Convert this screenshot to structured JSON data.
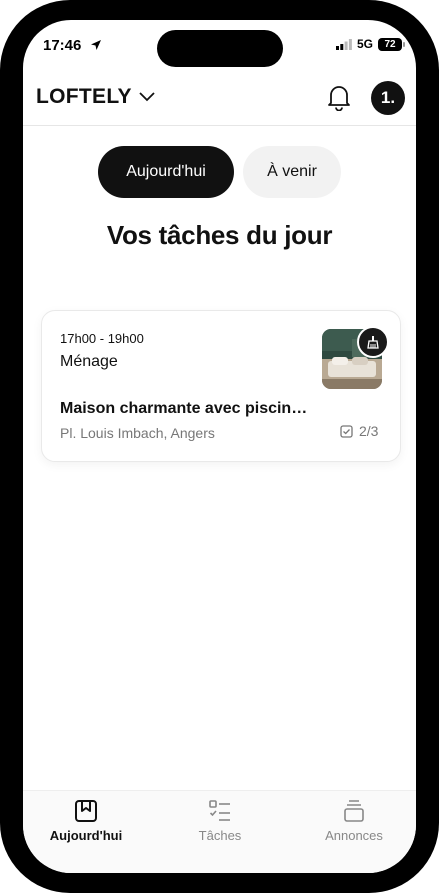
{
  "status_bar": {
    "time": "17:46",
    "network": "5G",
    "battery": "72"
  },
  "header": {
    "brand": "LOFTELY",
    "avatar_initial": "1."
  },
  "tabs": [
    {
      "label": "Aujourd'hui",
      "active": true
    },
    {
      "label": "À venir",
      "active": false
    }
  ],
  "page_title": "Vos tâches du jour",
  "task_card": {
    "time_range": "17h00 - 19h00",
    "task_type": "Ménage",
    "property_title": "Maison charmante avec piscin…",
    "address": "Pl. Louis Imbach, Angers",
    "progress": "2/3"
  },
  "bottom_nav": [
    {
      "label": "Aujourd'hui",
      "icon": "calendar-bookmark-icon",
      "active": true
    },
    {
      "label": "Tâches",
      "icon": "checklist-icon",
      "active": false
    },
    {
      "label": "Annonces",
      "icon": "stack-icon",
      "active": false
    }
  ]
}
